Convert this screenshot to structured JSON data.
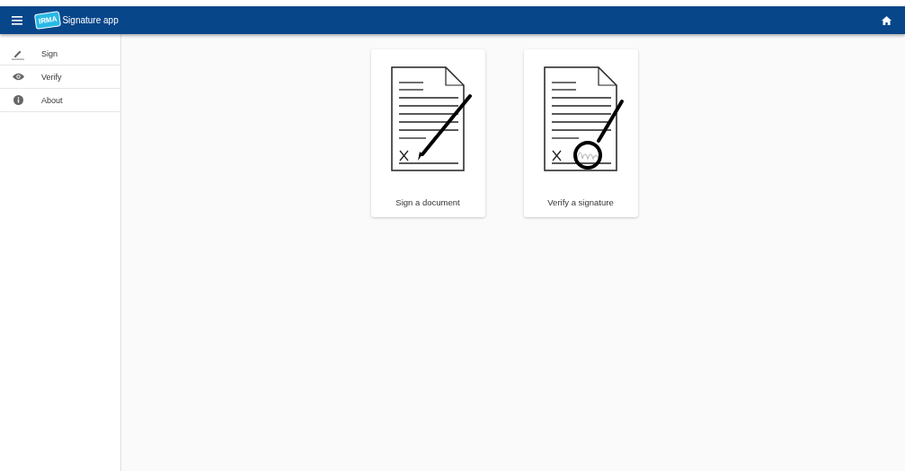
{
  "app_bar": {
    "logo_text": "IRMA",
    "title": "Signature app"
  },
  "sidebar": {
    "items": [
      {
        "label": "Sign",
        "kind": "pencil"
      },
      {
        "label": "Verify",
        "kind": "eye"
      },
      {
        "label": "About",
        "kind": "info"
      }
    ]
  },
  "cards": [
    {
      "label": "Sign a document",
      "kind": "sign"
    },
    {
      "label": "Verify a signature",
      "kind": "verify"
    }
  ]
}
